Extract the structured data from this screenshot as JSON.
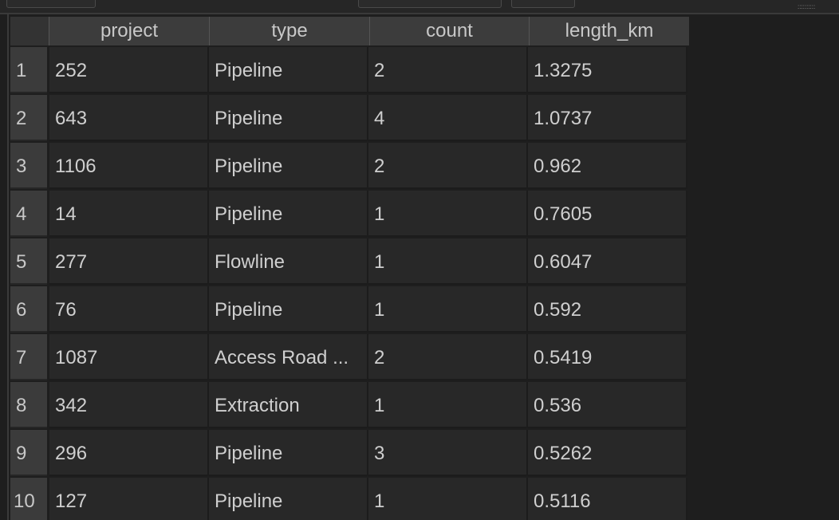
{
  "table": {
    "columns": [
      "project",
      "type",
      "count",
      "length_km"
    ],
    "rows": [
      {
        "index": "1",
        "project": "252",
        "type": "Pipeline",
        "count": "2",
        "length_km": "1.3275"
      },
      {
        "index": "2",
        "project": "643",
        "type": "Pipeline",
        "count": "4",
        "length_km": "1.0737"
      },
      {
        "index": "3",
        "project": "1106",
        "type": "Pipeline",
        "count": "2",
        "length_km": "0.962"
      },
      {
        "index": "4",
        "project": "14",
        "type": "Pipeline",
        "count": "1",
        "length_km": "0.7605"
      },
      {
        "index": "5",
        "project": "277",
        "type": "Flowline",
        "count": "1",
        "length_km": "0.6047"
      },
      {
        "index": "6",
        "project": "76",
        "type": "Pipeline",
        "count": "1",
        "length_km": "0.592"
      },
      {
        "index": "7",
        "project": "1087",
        "type": "Access Road ...",
        "count": "2",
        "length_km": "0.5419"
      },
      {
        "index": "8",
        "project": "342",
        "type": "Extraction",
        "count": "1",
        "length_km": "0.536"
      },
      {
        "index": "9",
        "project": "296",
        "type": "Pipeline",
        "count": "3",
        "length_km": "0.5262"
      },
      {
        "index": "10",
        "project": "127",
        "type": "Pipeline",
        "count": "1",
        "length_km": "0.5116"
      }
    ]
  }
}
